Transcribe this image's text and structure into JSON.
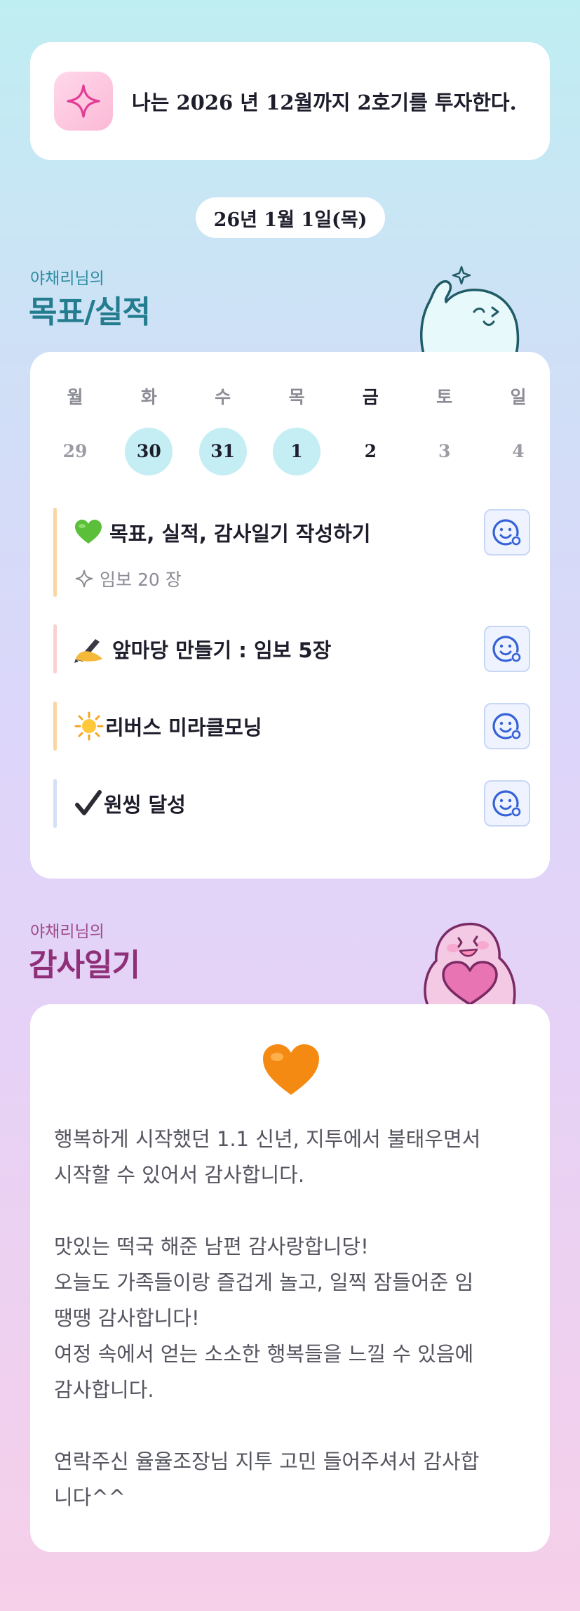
{
  "goal_banner": {
    "text": "나는 2026 년 12월까지 2호기를 투자한다.",
    "icon": "sparkle-icon"
  },
  "date_label": "26년 1월 1일(목)",
  "goals_section": {
    "subtitle": "야채리님의",
    "title": "목표/실적",
    "subtitle_color": "#2b8ca0",
    "title_color": "#237d8f"
  },
  "calendar": {
    "weekdays": [
      "월",
      "화",
      "수",
      "목",
      "금",
      "토",
      "일"
    ],
    "days": [
      "29",
      "30",
      "31",
      "1",
      "2",
      "3",
      "4"
    ],
    "completed_days": [
      "30",
      "31",
      "1"
    ],
    "today": "2"
  },
  "tasks": [
    {
      "emoji": "green-heart-icon",
      "title": "목표, 실적, 감사일기 작성하기",
      "meta": "임보 20 장",
      "bar_color": "#fbd6a3"
    },
    {
      "emoji": "writing-hand-icon",
      "title": "앞마당 만들기 : 임보 5장",
      "bar_color": "#fad0d0"
    },
    {
      "emoji": "sun-icon",
      "title": "리버스 미라클모닝",
      "bar_color": "#fbd6a3"
    },
    {
      "emoji": "check-mark-icon",
      "title": "원씽 달성",
      "bar_color": "#d3e0fa"
    }
  ],
  "diary_section": {
    "subtitle": "야채리님의",
    "title": "감사일기",
    "subtitle_color": "#a04a8a",
    "title_color": "#8e2f78"
  },
  "diary": {
    "emoji": "orange-heart-icon",
    "text": "행복하게 시작했던 1.1 신년, 지투에서 불태우면서\n시작할 수 있어서 감사합니다.\n\n맛있는 떡국 해준 남편 감사랑합니당!\n오늘도 가족들이랑 즐겁게 놀고, 일찍 잠들어준 임\n땡땡 감사합니다!\n여정 속에서 얻는 소소한 행복들을 느낄 수 있음에\n감사합니다.\n\n연락주신 율율조장님 지투 고민 들어주셔서 감사합\n니다^^"
  }
}
